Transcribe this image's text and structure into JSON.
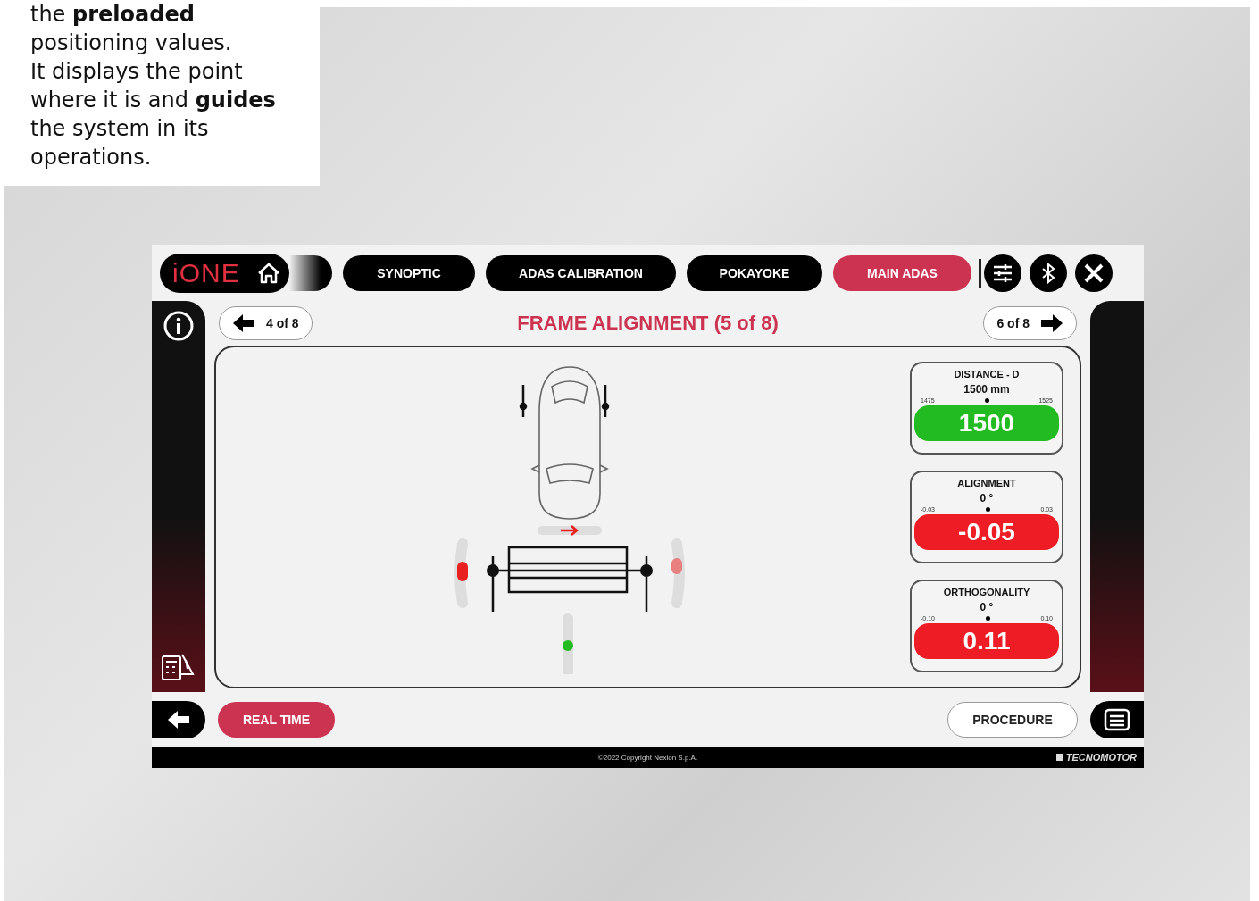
{
  "caption": {
    "lines": [
      "the **preloaded**",
      "positioning values.",
      "It displays the point",
      "where it is and **guides**",
      "the system in its",
      "operations."
    ]
  },
  "app": {
    "logo": "iONE",
    "tabs": [
      {
        "label": "SYNOPTIC",
        "selected": false
      },
      {
        "label": "ADAS CALIBRATION",
        "selected": false
      },
      {
        "label": "POKAYOKE",
        "selected": false
      },
      {
        "label": "MAIN ADAS",
        "selected": true
      }
    ],
    "prev": "4 of 8",
    "title": "FRAME ALIGNMENT (5 of 8)",
    "next": "6 of 8",
    "gauges": [
      {
        "title": "DISTANCE - D",
        "setpoint": "1500 mm",
        "min": "1475",
        "max": "1525",
        "reading": "1500",
        "color": "#22bb22"
      },
      {
        "title": "ALIGNMENT",
        "setpoint": "0 °",
        "min": "-0.03",
        "max": "0.03",
        "reading": "-0.05",
        "color": "#ee1c24"
      },
      {
        "title": "ORTHOGONALITY",
        "setpoint": "0 °",
        "min": "-0.10",
        "max": "0.10",
        "reading": "0.11",
        "color": "#ee1c24"
      }
    ],
    "real_time": "REAL TIME",
    "procedure": "PROCEDURE",
    "copyright": "©2022 Copyright Nexion S.p.A.",
    "brand": "TECNOMOTOR"
  }
}
